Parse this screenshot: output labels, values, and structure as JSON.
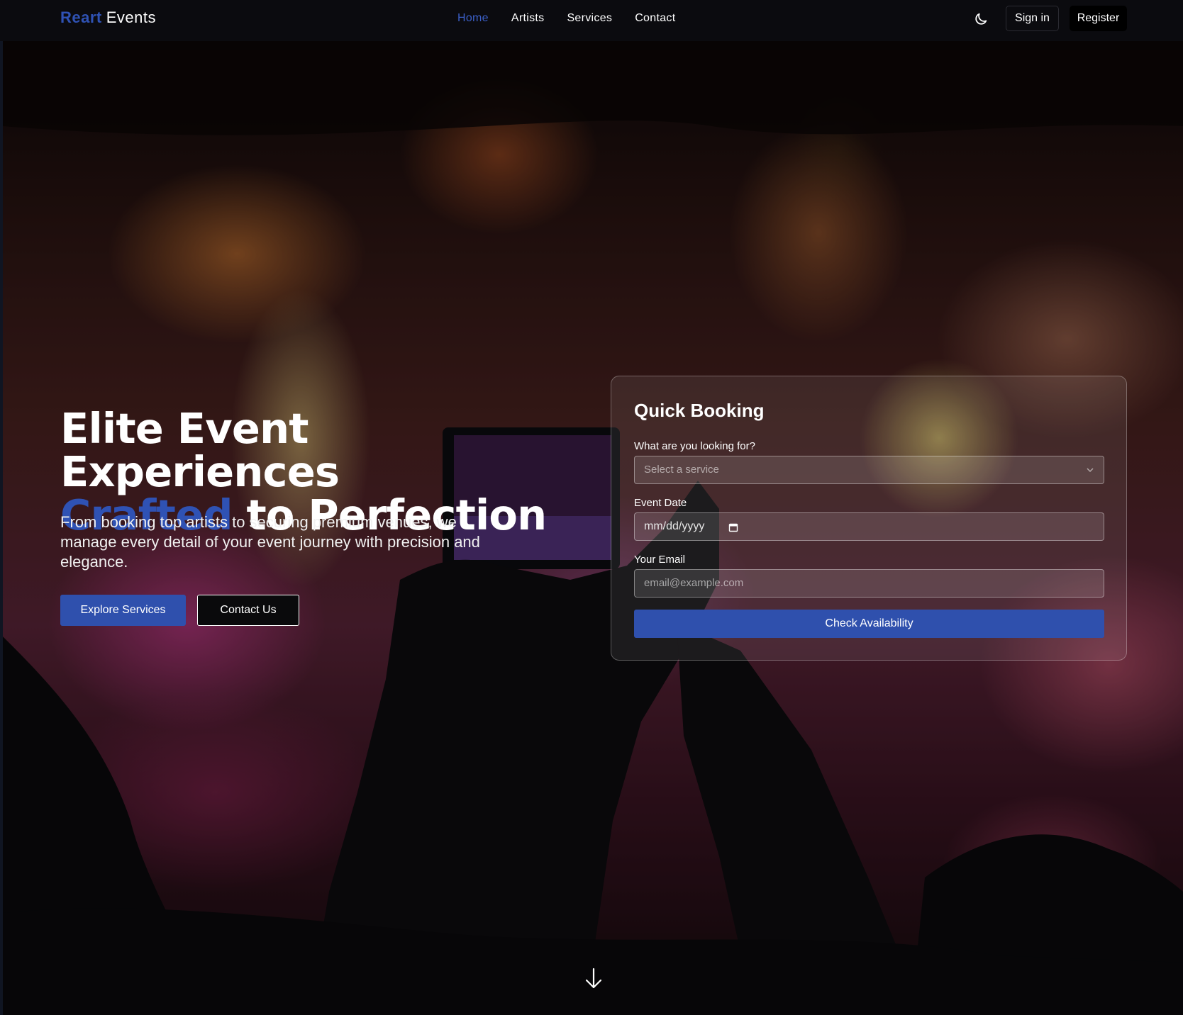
{
  "brand": {
    "accent": "Reart",
    "rest": "Events"
  },
  "nav": {
    "links": [
      {
        "label": "Home",
        "active": true
      },
      {
        "label": "Artists"
      },
      {
        "label": "Services"
      },
      {
        "label": "Contact"
      }
    ],
    "theme_icon": "moon-icon",
    "signin_label": "Sign in",
    "register_label": "Register"
  },
  "hero": {
    "title_line1": "Elite Event Experiences",
    "title_highlight": "Crafted",
    "title_line2_rest": " to Perfection",
    "subtitle": "From booking top artists to securing premium venues, we manage every detail of your event journey with precision and elegance.",
    "primary_button": "Explore Services",
    "secondary_button": "Contact Us"
  },
  "booking": {
    "title": "Quick Booking",
    "service_label": "What are you looking for?",
    "service_placeholder": "Select a service",
    "date_label": "Event Date",
    "date_placeholder": "mm/dd/yyyy",
    "email_label": "Your Email",
    "email_placeholder": "email@example.com",
    "submit_label": "Check Availability"
  },
  "colors": {
    "accent": "#2f52b4",
    "button_primary": "#2f50ad",
    "navbar_bg": "#0b0b0f"
  },
  "icons": {
    "scroll": "arrow-down-icon",
    "select": "chevron-down-icon",
    "date": "calendar-icon"
  }
}
